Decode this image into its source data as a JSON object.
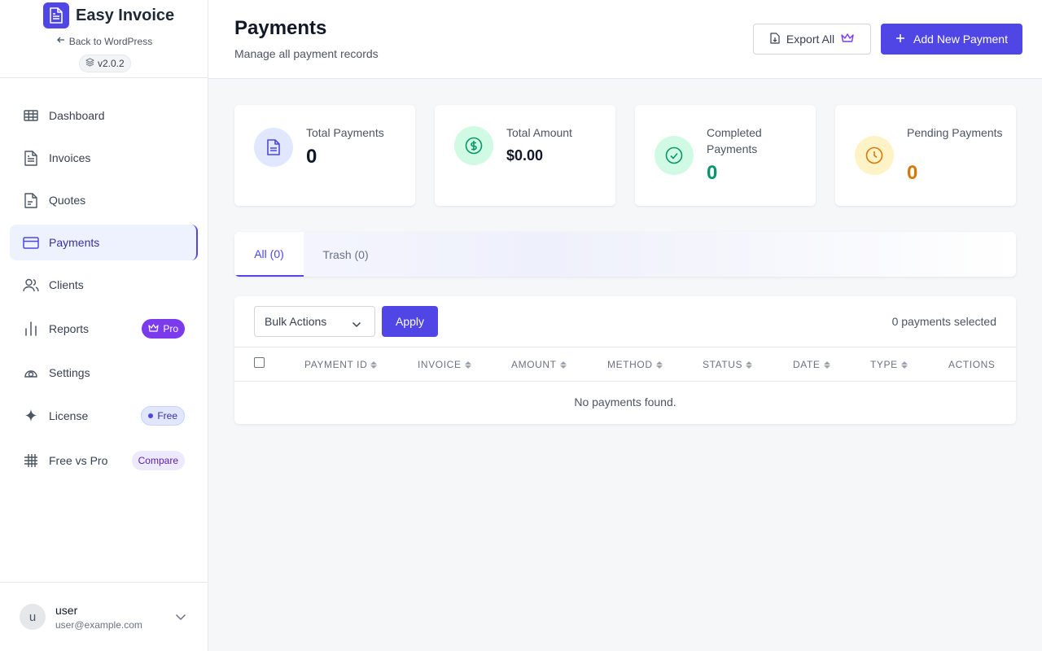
{
  "brand": {
    "name": "Easy Invoice",
    "back_label": "Back to WordPress",
    "version": "v2.0.2"
  },
  "nav": {
    "items": [
      {
        "label": "Dashboard",
        "icon": "grid-icon"
      },
      {
        "label": "Invoices",
        "icon": "file-text-icon"
      },
      {
        "label": "Quotes",
        "icon": "file-quote-icon"
      },
      {
        "label": "Payments",
        "icon": "credit-card-icon",
        "active": true
      },
      {
        "label": "Clients",
        "icon": "users-icon"
      },
      {
        "label": "Reports",
        "icon": "bar-chart-icon",
        "badge": "Pro"
      },
      {
        "label": "Settings",
        "icon": "gear-icon"
      },
      {
        "label": "License",
        "icon": "sparkle-icon",
        "badge": "Free"
      },
      {
        "label": "Free vs Pro",
        "icon": "compare-grid-icon",
        "badge": "Compare"
      }
    ]
  },
  "user": {
    "initial": "u",
    "name": "user",
    "email": "user@example.com"
  },
  "header": {
    "title": "Payments",
    "subtitle": "Manage all payment records",
    "export_label": "Export All",
    "add_label": "Add New Payment"
  },
  "stats": [
    {
      "label": "Total Payments",
      "value": "0",
      "color": "#111827",
      "icon_bg": "#e0e7ff",
      "icon_color": "#4f46e5"
    },
    {
      "label": "Total Amount",
      "value": "$0.00",
      "color": "#111827",
      "icon_bg": "#d1fae5",
      "icon_color": "#059669"
    },
    {
      "label": "Completed Payments",
      "value": "0",
      "color": "#059669",
      "icon_bg": "#d1fae5",
      "icon_color": "#059669"
    },
    {
      "label": "Pending Payments",
      "value": "0",
      "color": "#d97706",
      "icon_bg": "#fef3c7",
      "icon_color": "#d97706"
    }
  ],
  "tabs": [
    {
      "label": "All (0)",
      "active": true
    },
    {
      "label": "Trash (0)"
    }
  ],
  "table": {
    "bulk_label": "Bulk Actions",
    "apply_label": "Apply",
    "selected_text": "0 payments selected",
    "columns": [
      "PAYMENT ID",
      "INVOICE",
      "AMOUNT",
      "METHOD",
      "STATUS",
      "DATE",
      "TYPE",
      "ACTIONS"
    ],
    "empty_text": "No payments found."
  },
  "colors": {
    "accent": "#4f46e5",
    "pro_badge": "#7c3aed"
  }
}
